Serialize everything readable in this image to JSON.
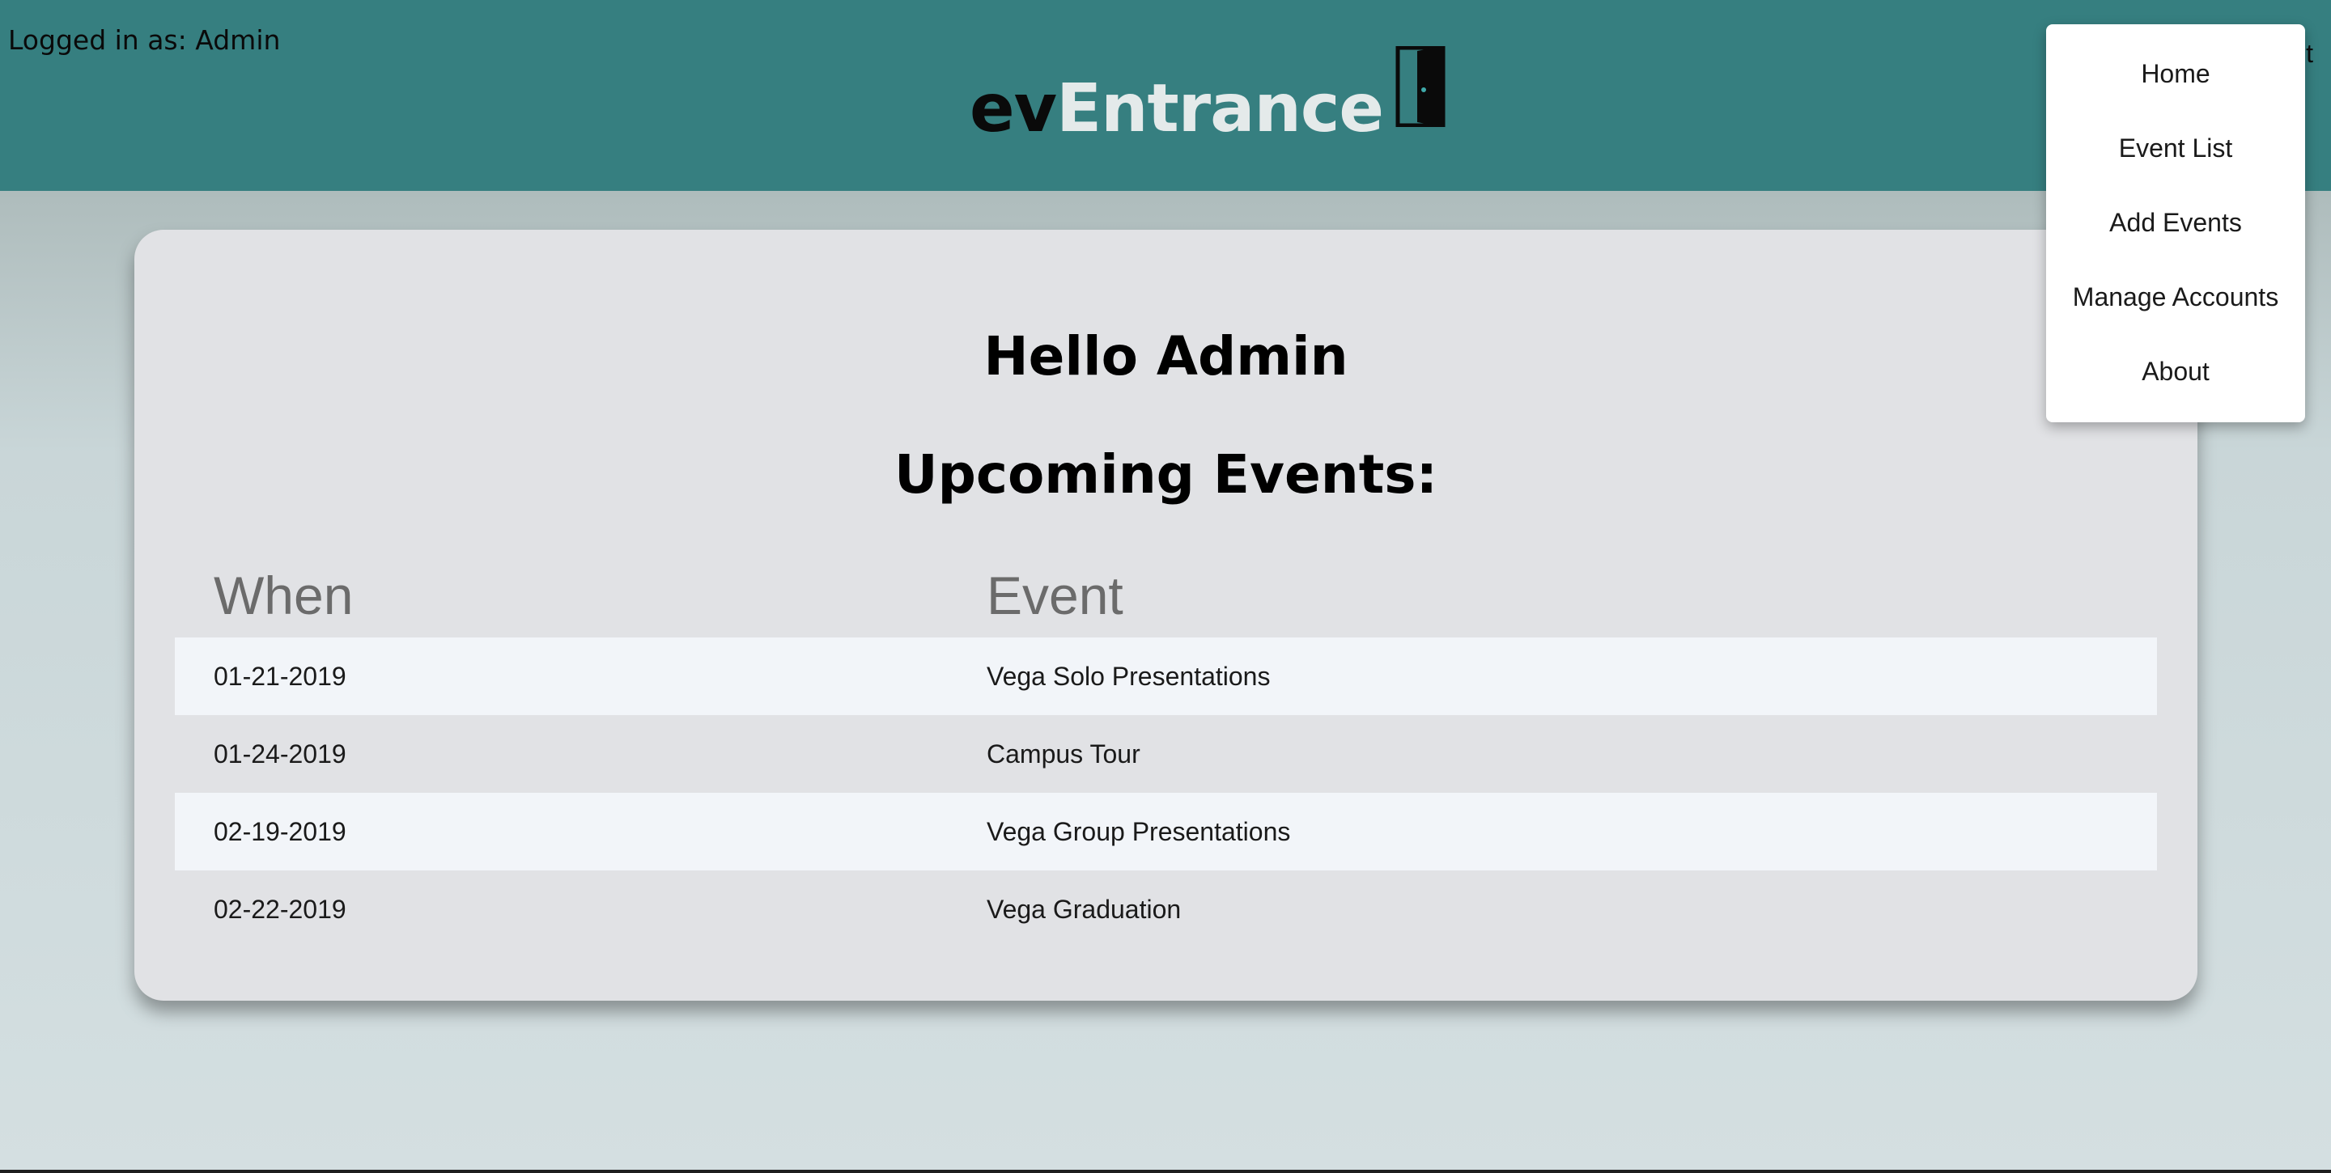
{
  "header": {
    "login_status": "Logged in as: Admin",
    "logo_part1": "ev",
    "logo_part2": "Entrance",
    "logo_icon": "door-icon",
    "partially_hidden_text": "t",
    "background_color": "#367f80"
  },
  "main": {
    "greeting": "Hello Admin",
    "section_title": "Upcoming Events:",
    "table": {
      "columns": [
        "When",
        "Event"
      ],
      "rows": [
        {
          "when": "01-21-2019",
          "event": "Vega Solo Presentations"
        },
        {
          "when": "01-24-2019",
          "event": "Campus Tour"
        },
        {
          "when": "02-19-2019",
          "event": "Vega Group Presentations"
        },
        {
          "when": "02-22-2019",
          "event": "Vega Graduation"
        }
      ]
    }
  },
  "menu": {
    "items": [
      {
        "label": "Home"
      },
      {
        "label": "Event List"
      },
      {
        "label": "Add Events"
      },
      {
        "label": "Manage Accounts"
      },
      {
        "label": "About"
      }
    ]
  }
}
